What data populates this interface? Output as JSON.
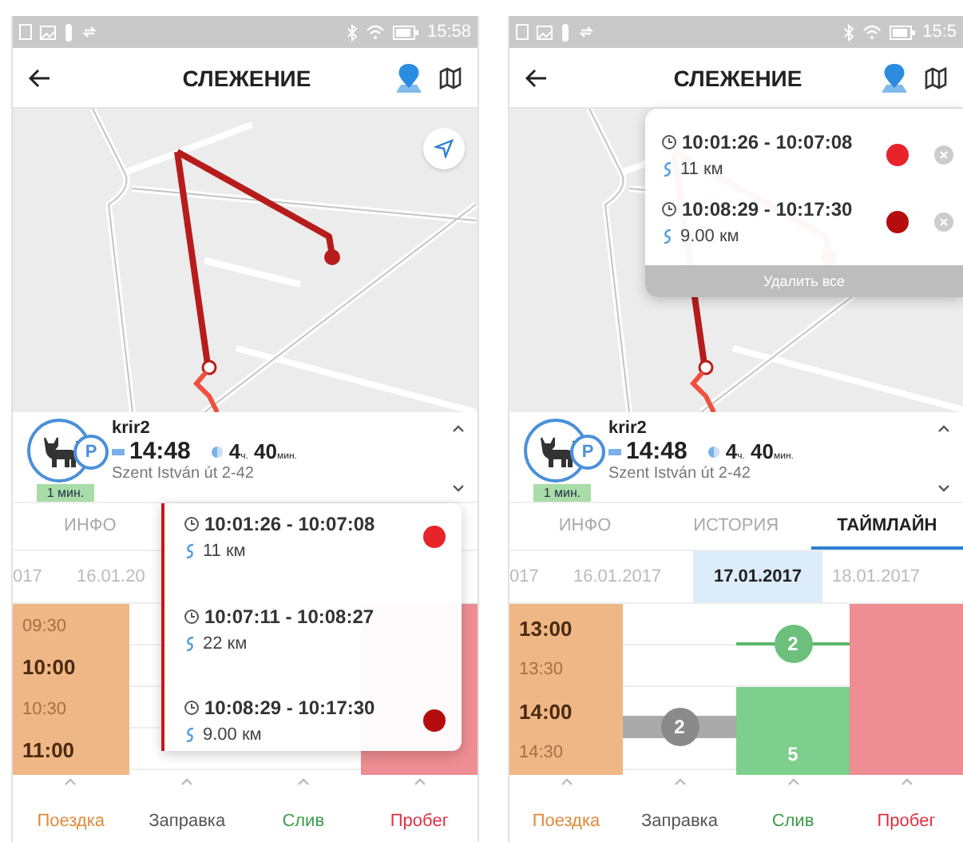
{
  "screens": [
    {
      "status_bar": {
        "time": "15:58"
      },
      "header": {
        "title": "СЛЕЖЕНИЕ"
      },
      "map": {
        "locate_button": true
      },
      "vehicle": {
        "name": "krir2",
        "time": "14:48",
        "duration": "4$_{ч.}$ 40$_{мин.}$",
        "address": "Szent István út 2-42",
        "age": "1 мин.",
        "status_letter": "P"
      },
      "tabs": [
        {
          "label": "ИНФО",
          "selected": false
        }
      ],
      "dates": [
        {
          "label": "017",
          "selected": false
        },
        {
          "label": "16.01.20",
          "selected": false
        }
      ],
      "timeline": {
        "times": [
          {
            "label": "09:30",
            "major": false
          },
          {
            "label": "10:00",
            "major": true
          },
          {
            "label": "10:30",
            "major": false
          },
          {
            "label": "11:00",
            "major": true
          }
        ]
      },
      "popup": {
        "kind": "timeline",
        "trips": [
          {
            "time": "10:01:26 - 10:07:08",
            "distance": "11 км",
            "color": "#e8232a"
          },
          {
            "time": "10:07:11 - 10:08:27",
            "distance": "22 км"
          },
          {
            "time": "10:08:29 - 10:17:30",
            "distance": "9.00 км",
            "color": "#b50d0d"
          }
        ]
      },
      "bottom_nav": [
        {
          "label": "Поездка",
          "color": "#e08a3c"
        },
        {
          "label": "Заправка",
          "color": "#555555"
        },
        {
          "label": "Слив",
          "color": "#3a9d4a"
        },
        {
          "label": "Пробег",
          "color": "#e0303f"
        }
      ]
    },
    {
      "status_bar": {
        "time": "15:5"
      },
      "header": {
        "title": "СЛЕЖЕНИЕ"
      },
      "vehicle": {
        "name": "krir2",
        "time": "14:48",
        "duration": "4$_{ч.}$ 40$_{мин.}$",
        "address": "Szent István út 2-42",
        "age": "1 мин.",
        "status_letter": "P"
      },
      "tabs": [
        {
          "label": "ИНФО",
          "selected": false
        },
        {
          "label": "ИСТОРИЯ",
          "selected": false
        },
        {
          "label": "ТАЙМЛАЙН",
          "selected": true
        }
      ],
      "dates": [
        {
          "label": "017",
          "selected": false
        },
        {
          "label": "16.01.2017",
          "selected": false
        },
        {
          "label": "17.01.2017",
          "selected": true
        },
        {
          "label": "18.01.2017",
          "selected": false
        }
      ],
      "timeline": {
        "times": [
          {
            "label": "13:00",
            "major": true
          },
          {
            "label": "13:30",
            "major": false
          },
          {
            "label": "14:00",
            "major": true
          },
          {
            "label": "14:30",
            "major": false
          }
        ],
        "badges": [
          {
            "label": "2",
            "kind": "drain-line"
          },
          {
            "label": "2",
            "kind": "refuel-bar"
          },
          {
            "label": "5",
            "kind": "drain-bar"
          }
        ]
      },
      "popup": {
        "kind": "map",
        "trips": [
          {
            "time": "10:01:26 - 10:07:08",
            "distance": "11 км",
            "color": "#e8232a",
            "removable": true
          },
          {
            "time": "10:08:29 - 10:17:30",
            "distance": "9.00 км",
            "color": "#b50d0d",
            "removable": true
          }
        ],
        "delete_all": "Удалить все"
      },
      "bottom_nav": [
        {
          "label": "Поездка",
          "color": "#e08a3c"
        },
        {
          "label": "Заправка",
          "color": "#555555"
        },
        {
          "label": "Слив",
          "color": "#3a9d4a"
        },
        {
          "label": "Пробег",
          "color": "#e0303f"
        }
      ]
    }
  ]
}
